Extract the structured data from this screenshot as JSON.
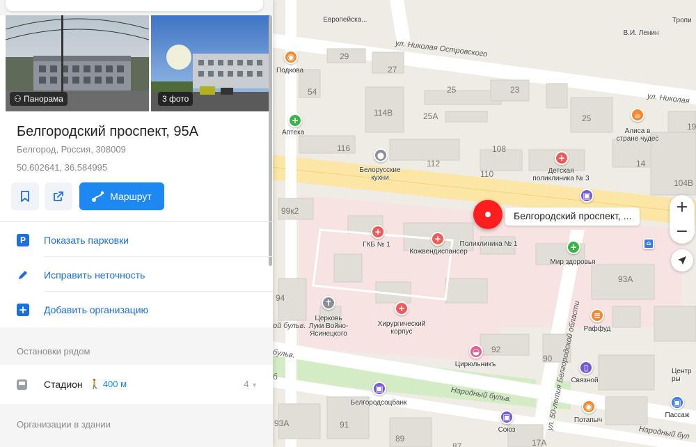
{
  "place": {
    "title": "Белгородский проспект, 95А",
    "address": "Белгород, Россия, 308009",
    "coords": "50.602641, 36.584995",
    "photos": [
      {
        "tag": "Панорама",
        "icon": "panorama-icon"
      },
      {
        "tag": "3 фото"
      }
    ]
  },
  "actions": {
    "bookmark_icon": "bookmark-icon",
    "share_icon": "share-icon",
    "route_label": "Маршрут",
    "accent": "#1e88f2"
  },
  "menu": [
    {
      "label": "Показать парковки",
      "icon": "parking-icon"
    },
    {
      "label": "Исправить неточность",
      "icon": "pencil-icon"
    },
    {
      "label": "Добавить организацию",
      "icon": "plus-square-icon"
    }
  ],
  "nearby": {
    "section_title": "Остановки рядом",
    "stop": {
      "name": "Стадион",
      "walk": "400 м",
      "count": "4"
    },
    "org_section_title": "Организации в здании"
  },
  "map": {
    "pin_label": "Белгородский проспект, ...",
    "streets": {
      "s1": "ул. Николая Островского",
      "s2": "ул. Николая",
      "s3": "Народный бульв.",
      "s4": "ул. 50-летия Белгородской области",
      "s5": "бульв.",
      "s6": "ой бульв.",
      "s7": "Народный бул",
      "s8": "Народный бульв."
    },
    "labels": {
      "europe": "Европейска...",
      "lenin": "В.И. Ленин",
      "tropic": "Тропи",
      "podkova": "Подкова",
      "apteka": "Аптека",
      "alisa": "Алиса в\nстране чудес",
      "belor": "Белорусские\nкухни",
      "detskaya": "Детская\nполиклиника № 3",
      "gkb": "ГКБ № 1",
      "kozhven": "Кожвендиспансер",
      "polik1": "Поликлиника № 1",
      "mir": "Мир здоровья",
      "raffud": "Раффуд",
      "tserkov": "Церковь\nЛуки Войно-\nЯсинецкого",
      "khirurg": "Хирургический\nкорпус",
      "tsiryul": "Цирюльникъ",
      "svyaznoy": "Связной",
      "tsentr": "Центр\nры",
      "belgorodsoc": "Белгородсоцбанк",
      "soyuz": "Союз",
      "potapych": "Потапыч",
      "passazh": "Пассаж"
    },
    "numbers": [
      "29",
      "27",
      "54",
      "25",
      "23",
      "114В",
      "25А",
      "25",
      "19",
      "116",
      "108",
      "112",
      "110",
      "14",
      "104В",
      "99к2",
      "93А",
      "94",
      "92",
      "90",
      "б",
      "93А",
      "91",
      "89",
      "87",
      "17А"
    ]
  }
}
